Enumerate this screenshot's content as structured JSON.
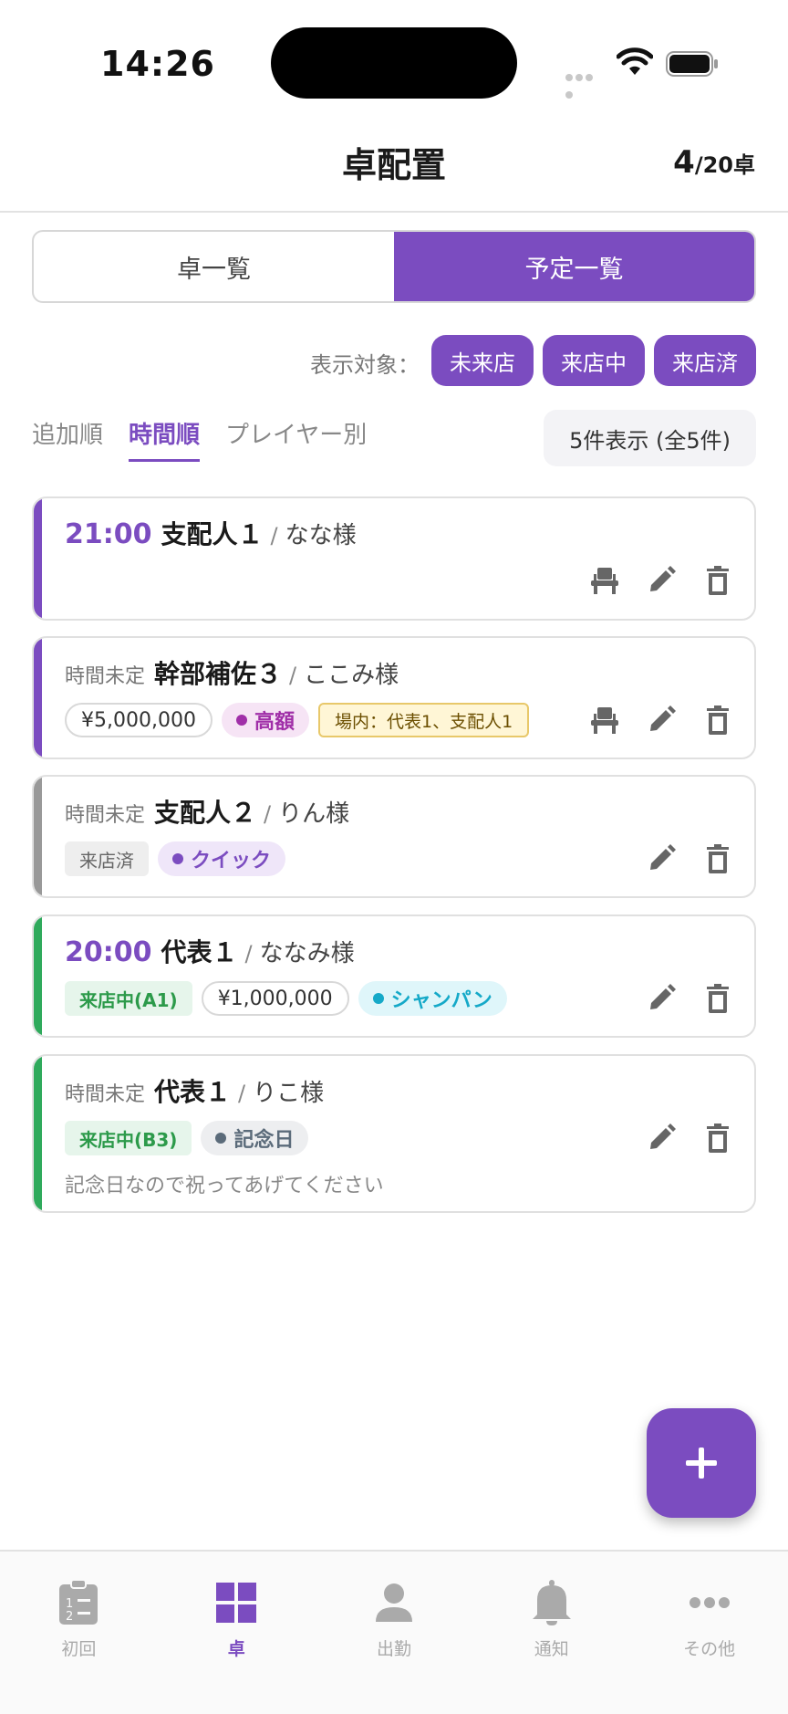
{
  "status_bar": {
    "time": "14:26"
  },
  "header": {
    "title": "卓配置",
    "count_current": "4",
    "count_total": "/20卓"
  },
  "segment": {
    "tabs": [
      "卓一覧",
      "予定一覧"
    ],
    "active_index": 1
  },
  "filter": {
    "label": "表示対象：",
    "chips": [
      "未来店",
      "来店中",
      "来店済"
    ]
  },
  "sort": {
    "tabs": [
      "追加順",
      "時間順",
      "プレイヤー別"
    ],
    "active_index": 1
  },
  "result_count": "5件表示 (全5件)",
  "colors": {
    "accent": "#7b4cc0",
    "green": "#2faa5c",
    "gray": "#999999"
  },
  "cards": [
    {
      "time": "21:00",
      "role": "支配人１",
      "sep": "/",
      "guest": "なな様"
    },
    {
      "time": "時間未定",
      "role": "幹部補佐３",
      "sep": "/",
      "guest": "ここみ様",
      "tags": {
        "money": "¥5,000,000",
        "level": "高額",
        "inner": "場内：代表1、支配人1"
      }
    },
    {
      "time": "時間未定",
      "role": "支配人２",
      "sep": "/",
      "guest": "りん様",
      "tags": {
        "status": "来店済",
        "type": "クイック"
      }
    },
    {
      "time": "20:00",
      "role": "代表１",
      "sep": "/",
      "guest": "ななみ様",
      "tags": {
        "status": "来店中(A1)",
        "money": "¥1,000,000",
        "type": "シャンパン"
      }
    },
    {
      "time": "時間未定",
      "role": "代表１",
      "sep": "/",
      "guest": "りこ様",
      "tags": {
        "status": "来店中(B3)",
        "type": "記念日"
      },
      "note": "記念日なので祝ってあげてください"
    }
  ],
  "fab": {
    "icon": "plus-icon"
  },
  "bottom_nav": {
    "items": [
      {
        "label": "初回",
        "icon": "clipboard-list-icon"
      },
      {
        "label": "卓",
        "icon": "grid-icon"
      },
      {
        "label": "出勤",
        "icon": "person-icon"
      },
      {
        "label": "通知",
        "icon": "bell-icon"
      },
      {
        "label": "その他",
        "icon": "more-dots-icon"
      }
    ],
    "active_index": 1
  }
}
